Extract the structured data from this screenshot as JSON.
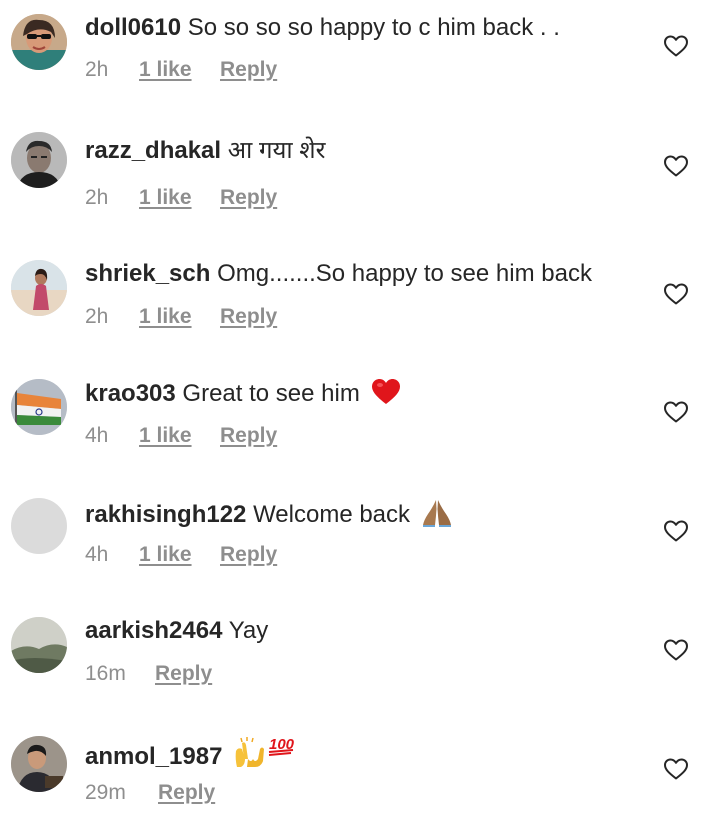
{
  "comments": [
    {
      "username": "doll0610",
      "text": "So so so so happy to c him back . .",
      "time": "2h",
      "likes": "1 like",
      "reply": "Reply",
      "avatar_icon": "user-avatar-woman-sunglasses"
    },
    {
      "username": "razz_dhakal",
      "text": "आ गया शेर",
      "time": "2h",
      "likes": "1 like",
      "reply": "Reply",
      "avatar_icon": "user-avatar-man-portrait"
    },
    {
      "username": "shriek_sch",
      "text": "Omg.......So happy to see him back",
      "time": "2h",
      "likes": "1 like",
      "reply": "Reply",
      "avatar_icon": "user-avatar-beach"
    },
    {
      "username": "krao303",
      "text": "Great to see him",
      "emoji": "red-heart-emoji",
      "time": "4h",
      "likes": "1 like",
      "reply": "Reply",
      "avatar_icon": "user-avatar-flag"
    },
    {
      "username": "rakhisingh122",
      "text": "Welcome back",
      "emoji": "folded-hands-emoji",
      "time": "4h",
      "likes": "1 like",
      "reply": "Reply",
      "avatar_icon": "user-avatar-default"
    },
    {
      "username": "aarkish2464",
      "text": "Yay",
      "time": "16m",
      "reply": "Reply",
      "avatar_icon": "user-avatar-landscape"
    },
    {
      "username": "anmol_1987",
      "text": "",
      "emoji": "raising-hands-and-hundred-points-emoji",
      "time": "29m",
      "reply": "Reply",
      "avatar_icon": "user-avatar-man-dark"
    }
  ],
  "like_icon": "heart-outline-icon",
  "colors": {
    "text": "#262626",
    "secondary": "#8e8e8e",
    "heart_red": "#e0151b"
  }
}
